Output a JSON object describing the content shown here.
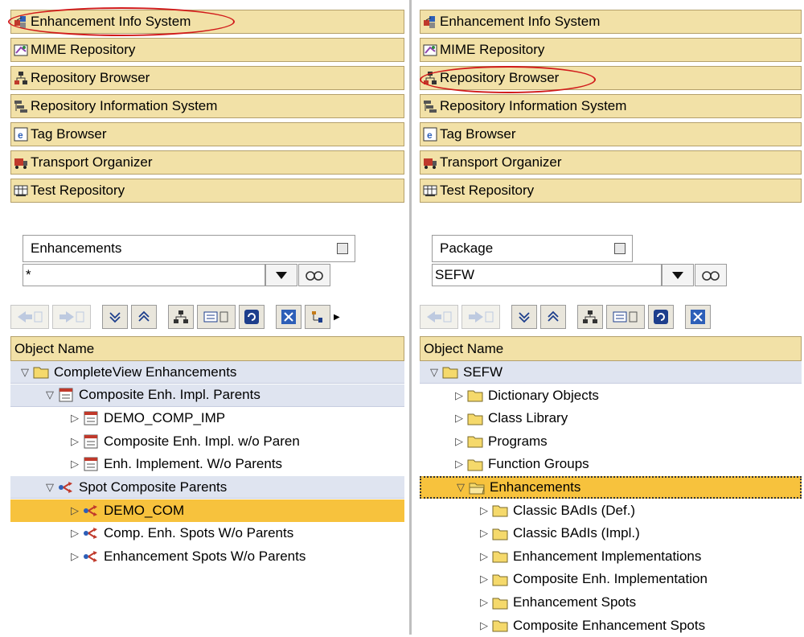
{
  "left": {
    "nav": [
      {
        "label": "Enhancement Info System",
        "icon": "enhancement-info-icon"
      },
      {
        "label": "MIME Repository",
        "icon": "mime-icon"
      },
      {
        "label": "Repository Browser",
        "icon": "repository-browser-icon"
      },
      {
        "label": "Repository Information System",
        "icon": "repository-info-icon"
      },
      {
        "label": "Tag Browser",
        "icon": "tag-browser-icon"
      },
      {
        "label": "Transport Organizer",
        "icon": "transport-icon"
      },
      {
        "label": "Test Repository",
        "icon": "test-repository-icon"
      }
    ],
    "select_value": "Enhancements",
    "input_value": "*",
    "column_header": "Object Name",
    "tree": [
      {
        "label": "CompleteView Enhancements",
        "level": 0,
        "caret": "down",
        "icon": "folder",
        "group": true
      },
      {
        "label": "Composite Enh. Impl. Parents",
        "level": 1,
        "caret": "down",
        "icon": "composite",
        "group": true
      },
      {
        "label": "DEMO_COMP_IMP",
        "level": 2,
        "caret": "right",
        "icon": "composite"
      },
      {
        "label": "Composite Enh. Impl. w/o Paren",
        "level": 2,
        "caret": "right",
        "icon": "composite"
      },
      {
        "label": "Enh. Implement. W/o Parents",
        "level": 2,
        "caret": "right",
        "icon": "composite"
      },
      {
        "label": "Spot Composite Parents",
        "level": 1,
        "caret": "down",
        "icon": "spot",
        "group": true
      },
      {
        "label": "DEMO_COM",
        "level": 2,
        "caret": "right",
        "icon": "spot",
        "selected": true
      },
      {
        "label": "Comp. Enh. Spots W/o Parents",
        "level": 2,
        "caret": "right",
        "icon": "spot"
      },
      {
        "label": "Enhancement Spots W/o Parents",
        "level": 2,
        "caret": "right",
        "icon": "spot"
      }
    ]
  },
  "right": {
    "nav": [
      {
        "label": "Enhancement Info System",
        "icon": "enhancement-info-icon"
      },
      {
        "label": "MIME Repository",
        "icon": "mime-icon"
      },
      {
        "label": "Repository Browser",
        "icon": "repository-browser-icon"
      },
      {
        "label": "Repository Information System",
        "icon": "repository-info-icon"
      },
      {
        "label": "Tag Browser",
        "icon": "tag-browser-icon"
      },
      {
        "label": "Transport Organizer",
        "icon": "transport-icon"
      },
      {
        "label": "Test Repository",
        "icon": "test-repository-icon"
      }
    ],
    "select_value": "Package",
    "input_value": "SEFW",
    "column_header": "Object Name",
    "tree": [
      {
        "label": "SEFW",
        "level": 0,
        "caret": "down",
        "icon": "folder",
        "group": true
      },
      {
        "label": "Dictionary Objects",
        "level": 1,
        "caret": "right",
        "icon": "folder"
      },
      {
        "label": "Class Library",
        "level": 1,
        "caret": "right",
        "icon": "folder"
      },
      {
        "label": "Programs",
        "level": 1,
        "caret": "right",
        "icon": "folder"
      },
      {
        "label": "Function Groups",
        "level": 1,
        "caret": "right",
        "icon": "folder"
      },
      {
        "label": "Enhancements",
        "level": 1,
        "caret": "down",
        "icon": "folder-open",
        "selected": true
      },
      {
        "label": "Classic BAdIs (Def.)",
        "level": 2,
        "caret": "right",
        "icon": "folder"
      },
      {
        "label": "Classic BAdIs (Impl.)",
        "level": 2,
        "caret": "right",
        "icon": "folder"
      },
      {
        "label": "Enhancement Implementations",
        "level": 2,
        "caret": "right",
        "icon": "folder"
      },
      {
        "label": "Composite Enh. Implementation",
        "level": 2,
        "caret": "right",
        "icon": "folder"
      },
      {
        "label": "Enhancement Spots",
        "level": 2,
        "caret": "right",
        "icon": "folder"
      },
      {
        "label": "Composite Enhancement Spots",
        "level": 2,
        "caret": "right",
        "icon": "folder"
      }
    ]
  },
  "colors": {
    "nav_bg": "#f2e1a7",
    "group_row_bg": "#dfe4f0",
    "selected_bg": "#f7c23d",
    "highlight": "#d11b1b",
    "folder": "#f5d96b"
  }
}
